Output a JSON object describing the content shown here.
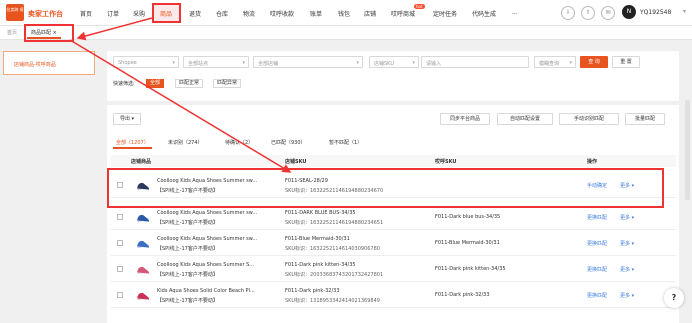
{
  "app": {
    "logo": "拉卖跨\n境",
    "brand": "卖家工作台"
  },
  "nav": [
    "首页",
    "订单",
    "采购",
    "商品",
    "退货",
    "仓库",
    "物流",
    "哎呼收款",
    "账单",
    "钱包",
    "店铺",
    "哎呼商城",
    "定时任务",
    "代码生成",
    "..."
  ],
  "nav_active": "商品",
  "hot_badge": "hot",
  "user": {
    "avatar": "N",
    "name": "YQ192548"
  },
  "breadcrumb": {
    "home": "首页",
    "tab": "商品匹配 ×"
  },
  "sidebar": {
    "item": "店铺商品-哎呼商品"
  },
  "filters": {
    "shop_type": "Shopee",
    "site": "全部站点",
    "shop": "全部店铺",
    "sku_type": "店铺SKU",
    "input_placeholder": "请输入",
    "match_mode": "模糊查询",
    "search": "查 询",
    "reset": "重 置",
    "quick_label": "快速筛选:",
    "chips": [
      "全部",
      "匹配正常",
      "匹配异常"
    ]
  },
  "toolbar": {
    "export": "导出",
    "sync": "同步平台商品",
    "auto_settings": "自动匹配设置",
    "manual_match": "手动识别匹配",
    "batch_match": "批量匹配"
  },
  "status_tabs": [
    "全部（1207）",
    "未识别（274）",
    "待确认（2）",
    "已匹配（930）",
    "暂不匹配（1）"
  ],
  "table": {
    "headers": [
      "店铺商品",
      "店铺SKU",
      "哎呼SKU",
      "操作"
    ],
    "rows": [
      {
        "name": "Coolloog Kids Aqua Shoes Summer sw...",
        "tag": "【SPI线上-17客户不要动】",
        "sku": "F011-SEAL-28/29",
        "skuid": "SKU标识：163225211461948802346​70",
        "ahu": "",
        "act1": "手动确定",
        "act2": "更多"
      },
      {
        "name": "Coolloog Kids Aqua Shoes Summer sw...",
        "tag": "【SPI线上-17客户不要动】",
        "sku": "F011-DARK BLUE BUS-34/35",
        "skuid": "SKU标识：163225211461948802346​51",
        "ahu": "F011-Dark blue bus-34/35",
        "act1": "更换匹配",
        "act2": "更多"
      },
      {
        "name": "Coolloog Kids Aqua Shoes Summer sw...",
        "tag": "【SPI线上-17客户不要动】",
        "sku": "F011-Blue Mermaid-30/31",
        "skuid": "SKU标识：163225211461403090​6780",
        "ahu": "F011-Blue Mermaid-30/31",
        "act1": "更换匹配",
        "act2": "更多"
      },
      {
        "name": "Coolloog Kids Aqua Shoes Summer S...",
        "tag": "【SPI线上-17客户不要动】",
        "sku": "F011-Dark pink kitten-34/35",
        "skuid": "SKU标识：200336837432017324278​01",
        "ahu": "F011-Dark pink kitten-34/35",
        "act1": "更换匹配",
        "act2": "更多"
      },
      {
        "name": "Kids Aqua Shoes Solid Color Beach Pl...",
        "tag": "【SPI线上-17客户不要动】",
        "sku": "F011-Dark pink-32/33",
        "skuid": "SKU标识：131895334241402136984​9",
        "ahu": "F011-Dark pink-32/33",
        "act1": "更换匹配",
        "act2": "更多"
      }
    ]
  },
  "colors": {
    "accent": "#e8541e",
    "link": "#3a7be0",
    "highlight": "#ee3333"
  }
}
